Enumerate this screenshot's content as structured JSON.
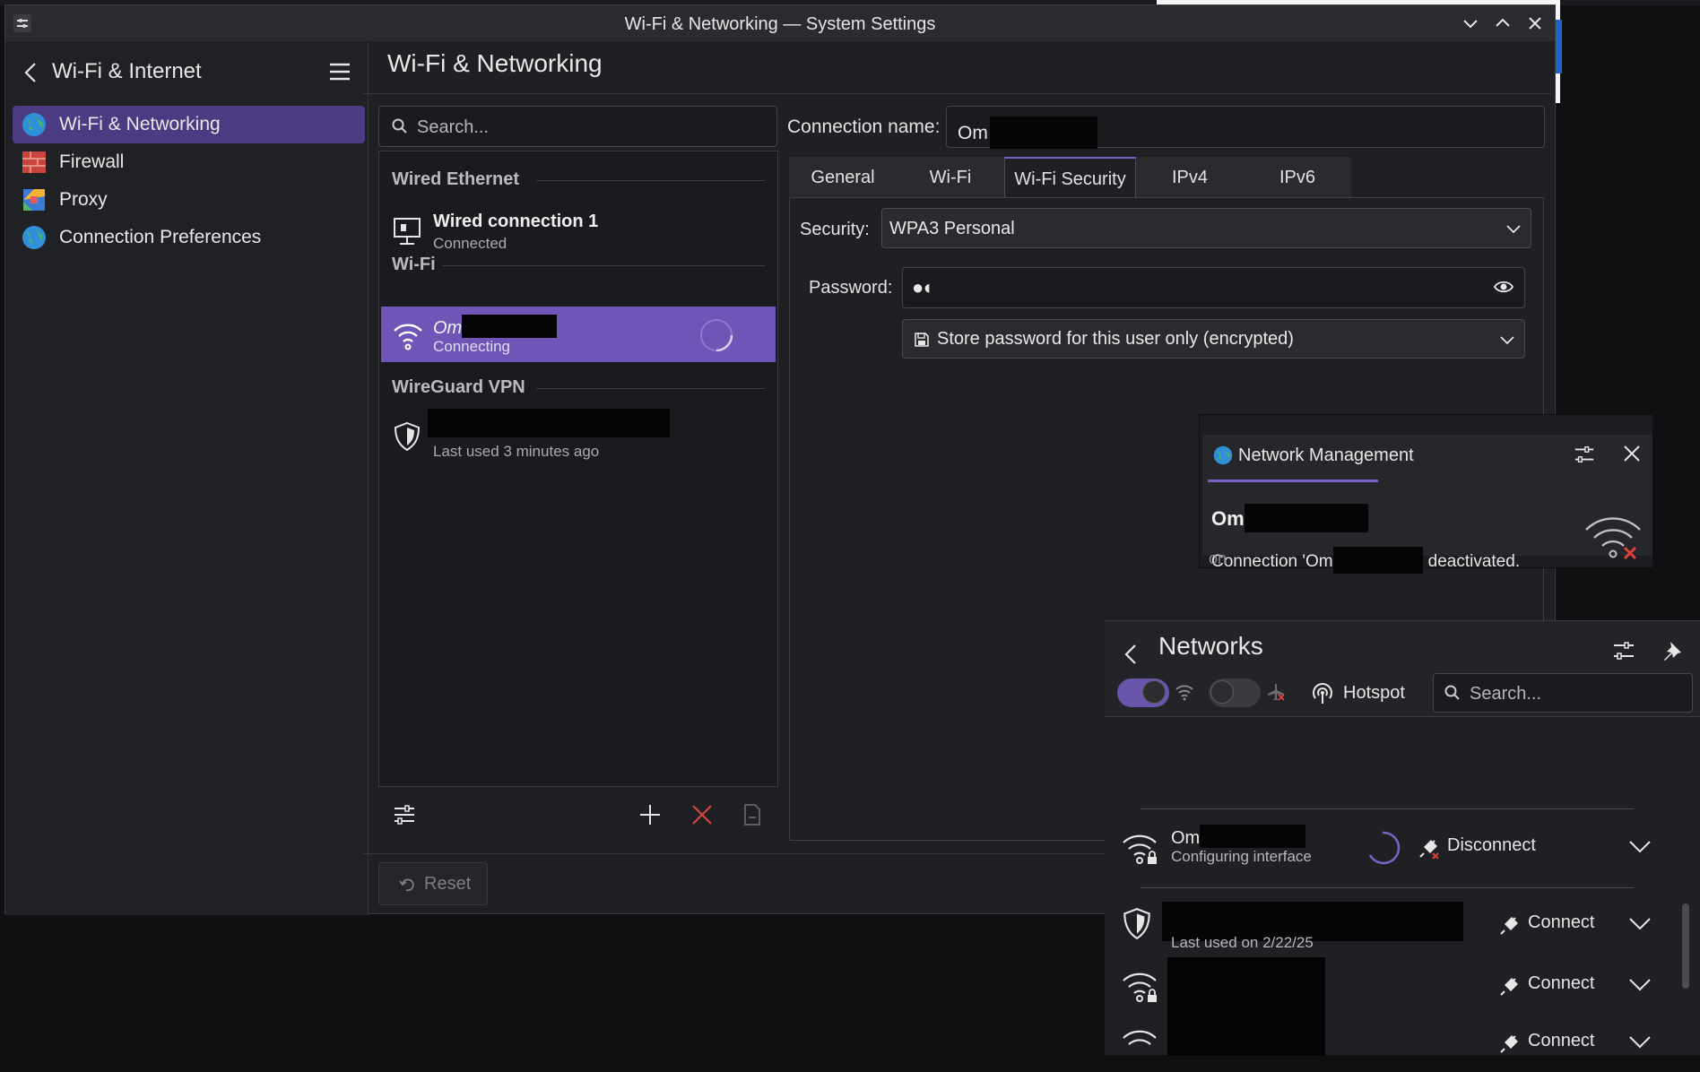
{
  "window": {
    "title": "Wi-Fi & Networking — System Settings"
  },
  "sidebar": {
    "title": "Wi-Fi & Internet",
    "items": [
      {
        "label": "Wi-Fi & Networking"
      },
      {
        "label": "Firewall"
      },
      {
        "label": "Proxy"
      },
      {
        "label": "Connection Preferences"
      }
    ]
  },
  "content": {
    "title": "Wi-Fi & Networking"
  },
  "connections": {
    "search_placeholder": "Search...",
    "sections": [
      {
        "title": "Wired Ethernet"
      },
      {
        "title": "Wi-Fi"
      },
      {
        "title": "WireGuard VPN"
      }
    ],
    "wired": {
      "name": "Wired connection 1",
      "status": "Connected"
    },
    "wifi": {
      "name": "Om",
      "status": "Connecting"
    },
    "vpn": {
      "status": "Last used 3 minutes ago"
    }
  },
  "details": {
    "connection_name_label": "Connection name:",
    "connection_name_value": "Om",
    "tabs": [
      "General",
      "Wi-Fi",
      "Wi-Fi Security",
      "IPv4",
      "IPv6"
    ],
    "active_tab": "Wi-Fi Security",
    "security_label": "Security:",
    "security_value": "WPA3 Personal",
    "password_label": "Password:",
    "password_value": "●◖",
    "store_value": "Store password for this user only (encrypted)"
  },
  "footer": {
    "reset_label": "Reset"
  },
  "notification": {
    "app": "Network Management",
    "heading": "Om",
    "body_prefix": "Connection 'Om",
    "body_suffix": "deactivated.",
    "behind_text": "on"
  },
  "networks": {
    "title": "Networks",
    "hotspot_label": "Hotspot",
    "search_placeholder": "Search...",
    "rows": [
      {
        "name": "Om",
        "status": "Configuring interface",
        "action": "Disconnect"
      },
      {
        "status": "Last used on 2/22/25",
        "action": "Connect"
      },
      {
        "action": "Connect"
      },
      {
        "action": "Connect"
      }
    ]
  }
}
